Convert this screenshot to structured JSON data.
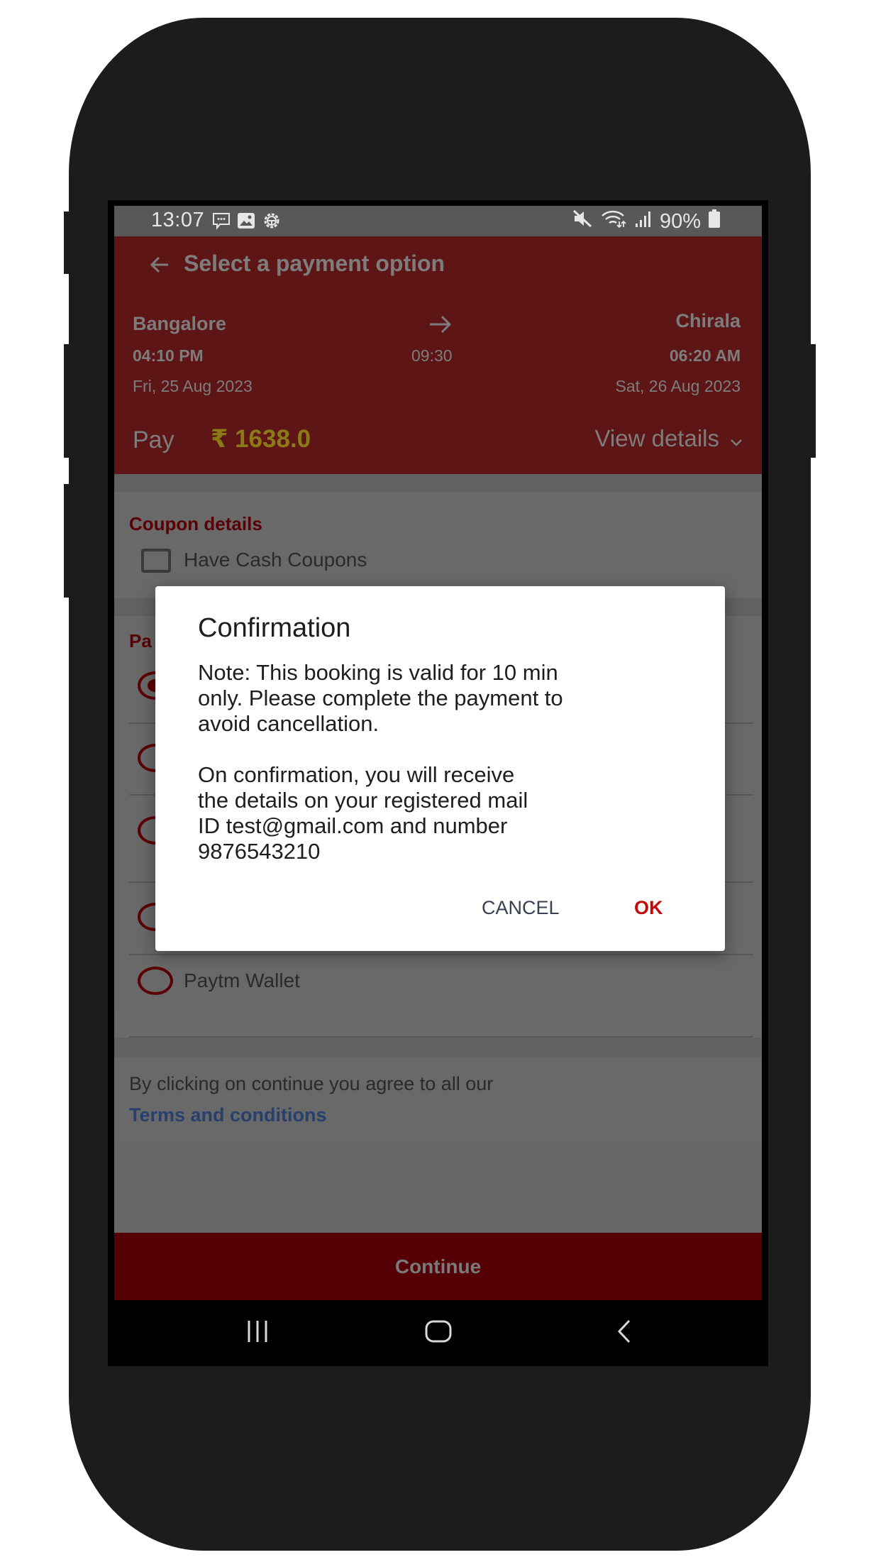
{
  "status_bar": {
    "time": "13:07",
    "left_icons": [
      "message-icon",
      "image-icon",
      "settings-icon"
    ],
    "right_icons": [
      "mute-icon",
      "wifi-icon",
      "signal-icon"
    ],
    "battery": "90%"
  },
  "header": {
    "title": "Select a payment option",
    "from_city": "Bangalore",
    "to_city": "Chirala",
    "departure_time": "04:10 PM",
    "duration": "09:30",
    "arrival_time": "06:20 AM",
    "departure_date": "Fri, 25 Aug 2023",
    "arrival_date": "Sat, 26 Aug 2023",
    "pay_label": "Pay",
    "pay_amount": "₹ 1638.0",
    "view_details": "View details"
  },
  "coupon": {
    "title": "Coupon details",
    "checkbox_label": "Have Cash Coupons",
    "checked": false
  },
  "payment": {
    "title_visible": "Pa",
    "options": [
      {
        "label": "",
        "selected": true
      },
      {
        "label": "",
        "selected": false
      },
      {
        "label": "",
        "selected": false
      },
      {
        "label": "",
        "selected": false
      },
      {
        "label": "Paytm Wallet",
        "selected": false
      }
    ]
  },
  "terms": {
    "text": "By clicking on continue you agree to all our",
    "link": "Terms and conditions"
  },
  "continue_label": "Continue",
  "dialog": {
    "title": "Confirmation",
    "message": "Note: This booking is valid for 10 min\nonly. Please complete the payment to\navoid cancellation.\n\nOn confirmation, you will receive\nthe details on your registered mail\nID test@gmail.com and number\n9876543210",
    "cancel_label": "CANCEL",
    "ok_label": "OK"
  },
  "colors": {
    "brand_red": "#5e1516",
    "accent_red": "#c20a0a",
    "link_blue": "#28406e",
    "amount_gold": "#8a7a18"
  }
}
